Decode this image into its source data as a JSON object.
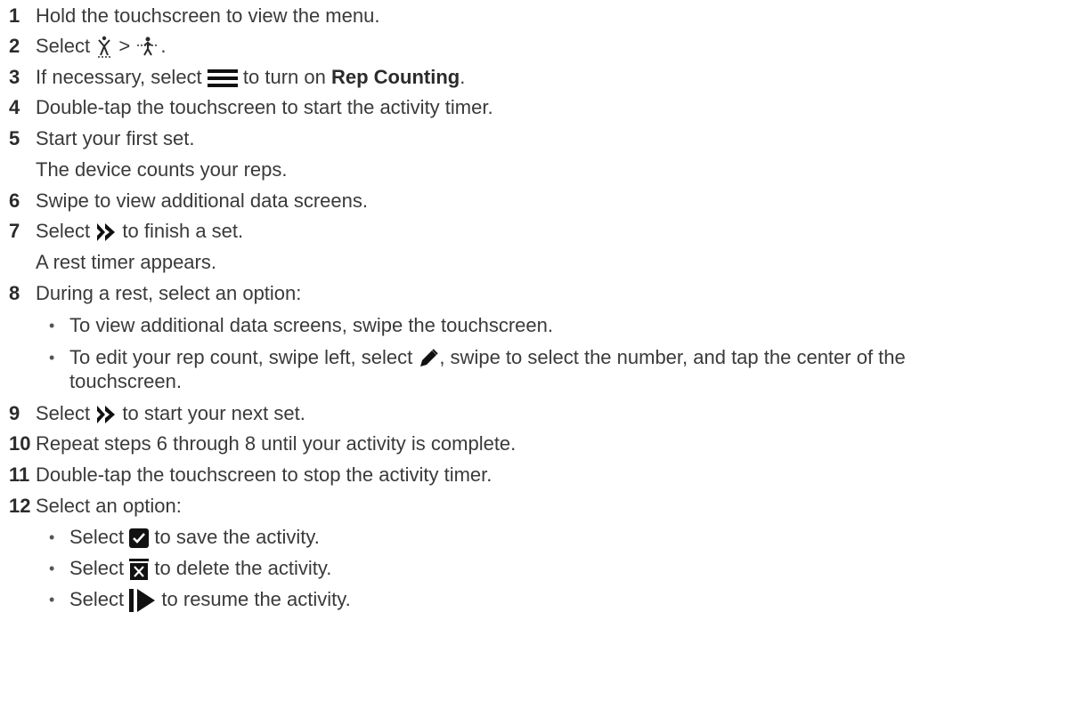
{
  "steps": [
    {
      "num": "1",
      "text": "Hold the touchscreen to view the menu."
    },
    {
      "num": "2",
      "pre": "Select",
      "sep": ">",
      "post": "."
    },
    {
      "num": "3",
      "pre": "If necessary, select",
      "post": "to turn on",
      "bold": "Rep Counting",
      "end": "."
    },
    {
      "num": "4",
      "text": "Double-tap the touchscreen to start the activity timer."
    },
    {
      "num": "5",
      "text": "Start your first set.",
      "note": "The device counts your reps."
    },
    {
      "num": "6",
      "text": "Swipe to view additional data screens."
    },
    {
      "num": "7",
      "pre": "Select",
      "post": "to finish a set.",
      "note": "A rest timer appears."
    },
    {
      "num": "8",
      "text": "During a rest, select an option:",
      "bullets": [
        {
          "text": "To view additional data screens, swipe the touchscreen."
        },
        {
          "pre": "To edit your rep count, swipe left, select",
          "post": ", swipe to select the number, and tap the center of the",
          "cont": "touchscreen."
        }
      ]
    },
    {
      "num": "9",
      "pre": "Select",
      "post": "to start your next set."
    },
    {
      "num": "10",
      "text": "Repeat steps 6 through 8 until your activity is complete."
    },
    {
      "num": "11",
      "text": "Double-tap the touchscreen to stop the activity timer."
    },
    {
      "num": "12",
      "text": "Select an option:",
      "bullets": [
        {
          "pre": "Select",
          "post": "to save the activity."
        },
        {
          "pre": "Select",
          "post": "to delete the activity."
        },
        {
          "pre": "Select",
          "post": "to resume the activity."
        }
      ]
    }
  ],
  "bullet_char": "•",
  "icons": {
    "activity": "person-activity-icon",
    "strength": "strength-training-icon",
    "menu": "menu-bars-icon",
    "next": "double-chevron-right-icon",
    "edit": "pencil-icon",
    "save": "checkbox-icon",
    "delete": "trash-x-icon",
    "resume": "resume-play-icon"
  }
}
